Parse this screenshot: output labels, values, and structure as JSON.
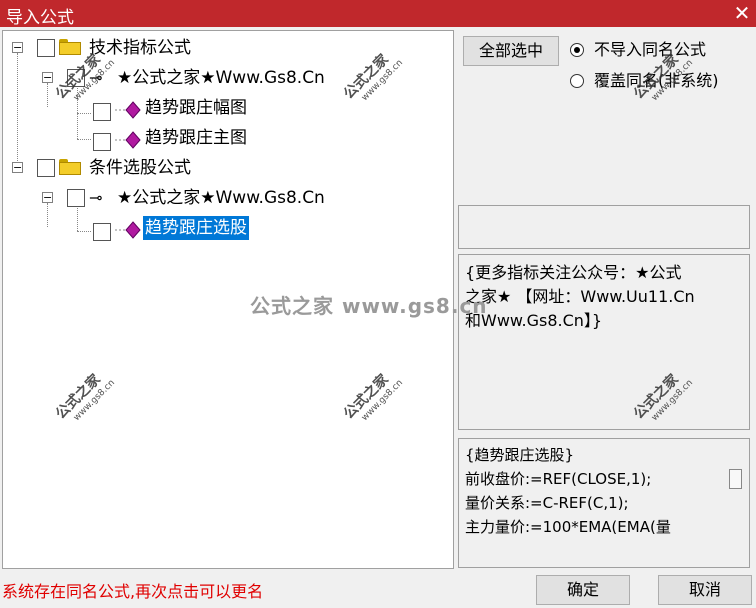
{
  "window": {
    "title": "导入公式",
    "close_glyph": "✕"
  },
  "tree": {
    "expander_glyph": "⊟",
    "nodes": {
      "tech": {
        "label": "技术指标公式"
      },
      "tech_home": {
        "label": "★公式之家★Www.Gs8.Cn",
        "icon": "key-icon"
      },
      "tech_item1": {
        "label": "趋势跟庄幅图",
        "icon": "gem-icon"
      },
      "tech_item2": {
        "label": "趋势跟庄主图",
        "icon": "gem-icon"
      },
      "cond": {
        "label": "条件选股公式"
      },
      "cond_home": {
        "label": "★公式之家★Www.Gs8.Cn",
        "icon": "key-icon"
      },
      "cond_item1": {
        "label": "趋势跟庄选股",
        "icon": "gem-icon",
        "selected": true
      }
    }
  },
  "options": {
    "select_all_label": "全部选中",
    "radio1_label": "不导入同名公式",
    "radio2_label": "覆盖同名(非系统)",
    "selected_radio": "radio1"
  },
  "description": {
    "line1": "{更多指标关注公众号：★公式",
    "line2": "之家★ 【网址：Www.Uu11.Cn",
    "line3": "和Www.Gs8.Cn】}"
  },
  "code": {
    "lines": [
      "{趋势跟庄选股}",
      "前收盘价:=REF(CLOSE,1);",
      "量价关系:=C-REF(C,1);",
      "主力量价:=100*EMA(EMA(量"
    ]
  },
  "footer": {
    "status": "系统存在同名公式,再次点击可以更名",
    "ok_label": "确定",
    "cancel_label": "取消"
  },
  "watermark": {
    "main": "公式之家",
    "url": "www.gs8.cn",
    "center": "公式之家 www.gs8.cn"
  },
  "colors": {
    "titlebar": "#c0282c",
    "selection": "#0078d7",
    "status_text": "#e00000",
    "folder": "#f3cd2a",
    "gem": "#b01aa0"
  }
}
